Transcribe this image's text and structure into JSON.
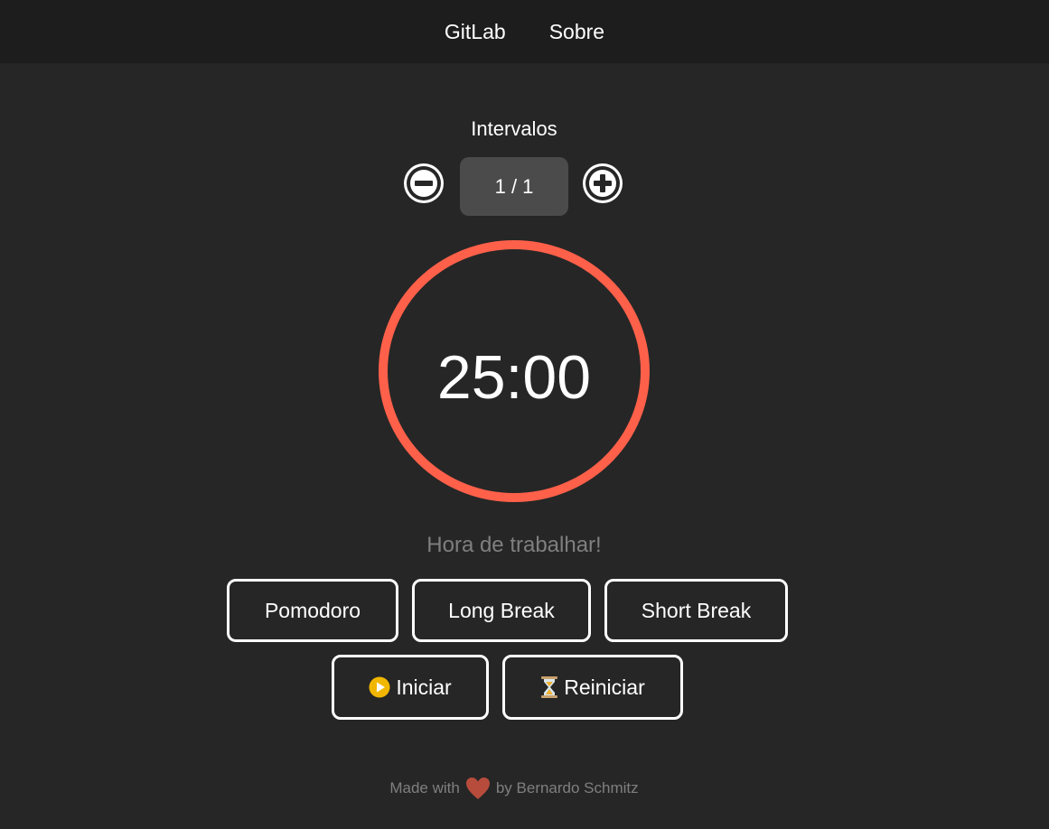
{
  "nav": {
    "gitlab_label": "GitLab",
    "about_label": "Sobre"
  },
  "intervals": {
    "label": "Intervalos",
    "value": "1 / 1",
    "current": 1,
    "total": 1
  },
  "timer": {
    "time": "25:00",
    "status": "Hora de trabalhar!",
    "ring_progress": 1.0,
    "ring_color": "#ff604a"
  },
  "modes": {
    "pomodoro_label": "Pomodoro",
    "long_break_label": "Long Break",
    "short_break_label": "Short Break"
  },
  "controls": {
    "start_label": "Iniciar",
    "start_icon": "play-icon",
    "reset_label": "Reiniciar",
    "reset_icon": "hourglass-icon"
  },
  "footer": {
    "made_with": "Made with",
    "heart_icon": "heart-icon",
    "by": "by Bernardo Schmitz"
  }
}
